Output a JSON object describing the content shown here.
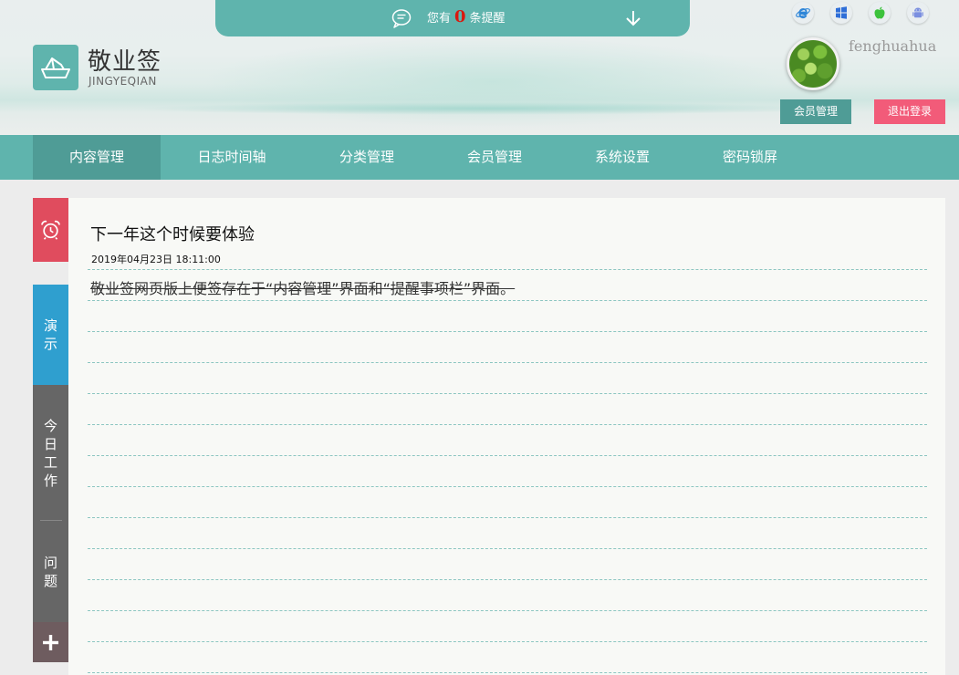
{
  "reminder": {
    "prefix": "您有",
    "count": "0",
    "suffix": "条提醒"
  },
  "brand": {
    "name": "敬业签",
    "sub": "JINGYEQIAN"
  },
  "platforms": [
    "ie-icon",
    "windows-icon",
    "apple-icon",
    "android-icon"
  ],
  "user": {
    "name": "fenghuahua"
  },
  "buttons": {
    "member": "会员管理",
    "logout": "退出登录"
  },
  "nav": {
    "items": [
      {
        "label": "内容管理",
        "active": true
      },
      {
        "label": "日志时间轴"
      },
      {
        "label": "分类管理"
      },
      {
        "label": "会员管理"
      },
      {
        "label": "系统设置"
      },
      {
        "label": "密码锁屏"
      }
    ]
  },
  "sidebar": {
    "demo": [
      "演",
      "示"
    ],
    "work": [
      "今",
      "日",
      "工",
      "作"
    ],
    "question": [
      "问",
      "题"
    ]
  },
  "note": {
    "title": "下一年这个时候要体验",
    "time": "2019年04月23日 18:11:00",
    "content": "敬业签网页版上便签存在于“内容管理”界面和“提醒事项栏”界面。"
  },
  "colors": {
    "teal": "#5fb4ad",
    "teal_dark": "#4f9c96",
    "alarm_red": "#e04c5e",
    "demo_blue": "#2f9fcf",
    "work_gray": "#666666",
    "logout_pink": "#f25b79",
    "count_red": "#d9180e"
  }
}
